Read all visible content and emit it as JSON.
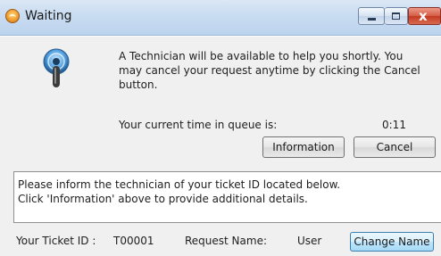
{
  "window": {
    "title": "Waiting",
    "controls": [
      "minimize",
      "maximize",
      "close"
    ],
    "close_glyph": "x",
    "icon": "help-lifebuoy-icon"
  },
  "main": {
    "status_icon": "waiting-signal-icon",
    "message_lines": [
      "A Technician will be available to help you shortly. You",
      "may cancel your request anytime by clicking the Cancel",
      "button."
    ],
    "queue_label": "Your current time in queue is:",
    "queue_time": "0:11",
    "buttons": {
      "information": "Information",
      "cancel": "Cancel"
    }
  },
  "notice": {
    "lines": [
      "Please inform the technician of your ticket ID located below.",
      "Click 'Information' above to provide additional details."
    ]
  },
  "footer": {
    "ticket_label": "Your Ticket ID :",
    "ticket_id": "T00001",
    "request_label": "Request Name:",
    "request_value": "User",
    "change_name_button": "Change Name"
  },
  "colors": {
    "titlebar": "#c9dcf1",
    "close_button": "#c33a22",
    "dialog_background": "#f0f0f0"
  }
}
